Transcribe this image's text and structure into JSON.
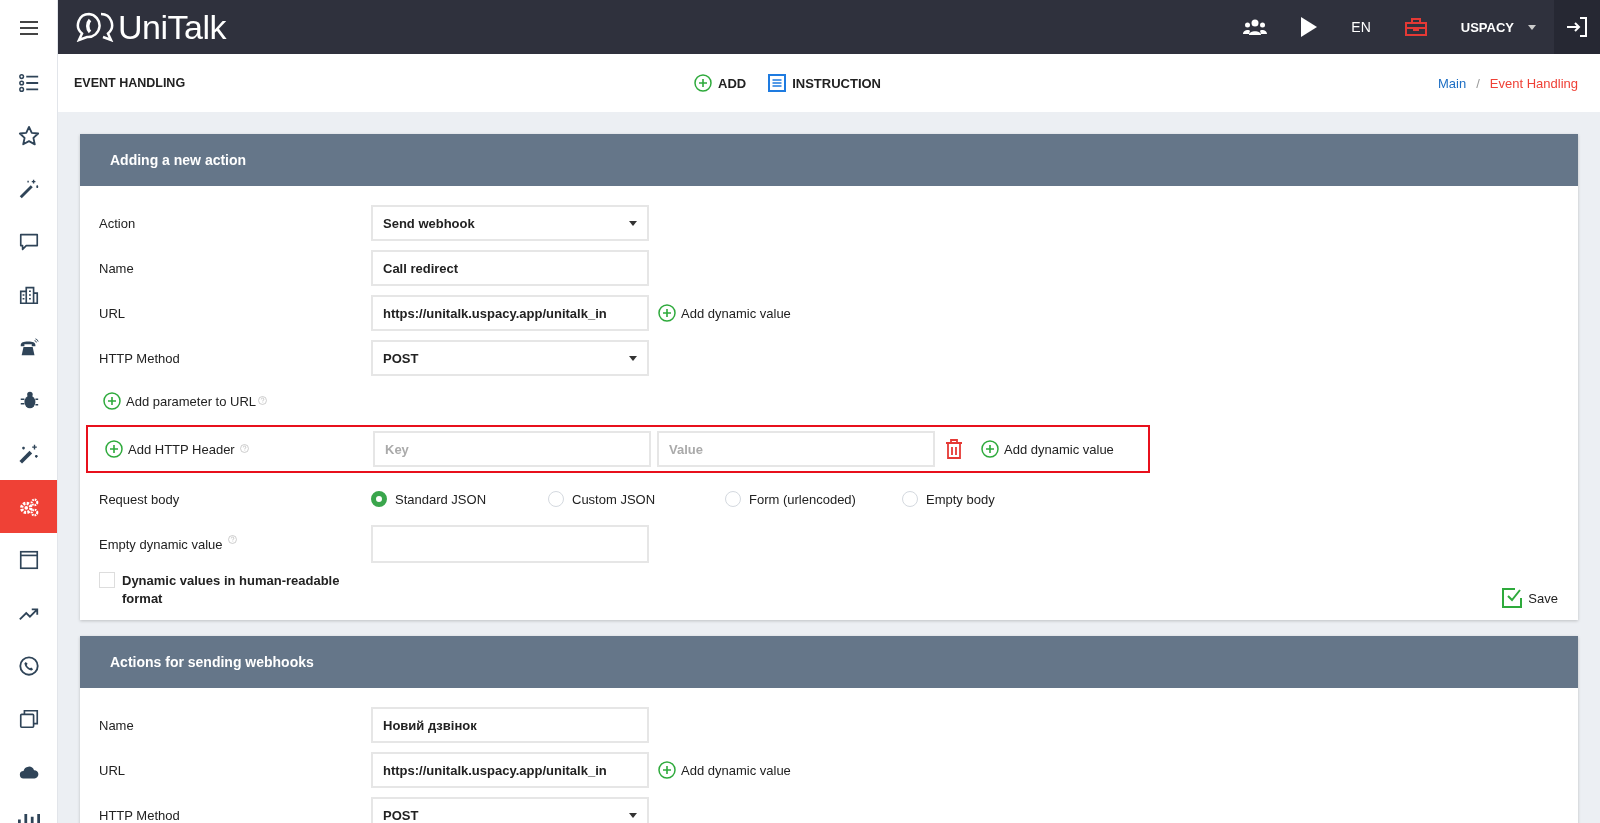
{
  "topbar": {
    "logo": "UniTalk",
    "language": "EN",
    "account": "USPACY"
  },
  "sidebar": {
    "items": [
      {
        "selected": false
      },
      {
        "selected": false
      },
      {
        "selected": false
      },
      {
        "selected": false
      },
      {
        "selected": false
      },
      {
        "selected": false
      },
      {
        "selected": false
      },
      {
        "selected": false
      },
      {
        "selected": true
      },
      {
        "selected": false
      },
      {
        "selected": false
      },
      {
        "selected": false
      },
      {
        "selected": false
      },
      {
        "selected": false
      },
      {
        "selected": false
      }
    ]
  },
  "page_header": {
    "title": "EVENT HANDLING",
    "actions": [
      {
        "kind": "add",
        "label": "ADD"
      },
      {
        "kind": "doc",
        "label": "INSTRUCTION"
      }
    ],
    "breadcrumb_separator": "/",
    "breadcrumbs": [
      {
        "label": "Main",
        "current": false
      },
      {
        "label": "Event Handling",
        "current": true
      }
    ]
  },
  "new_action": {
    "title": "Adding a new action",
    "rows": [
      {
        "kind": "select",
        "label": "Action",
        "value": "Send webhook"
      },
      {
        "kind": "text",
        "label": "Name",
        "value": "Call redirect"
      },
      {
        "kind": "text",
        "label": "URL",
        "value": "https://unitalk.uspacy.app/unitalk_in",
        "link": "Add dynamic value"
      },
      {
        "kind": "select",
        "label": "HTTP Method",
        "value": "POST"
      }
    ],
    "add_parameter": "Add parameter to URL",
    "header_row": {
      "label": "Add HTTP Header",
      "key_placeholder": "Key",
      "value_placeholder": "Value",
      "link": "Add dynamic value",
      "highlighted": true
    },
    "request_body": {
      "label": "Request body",
      "options": [
        {
          "label": "Standard JSON",
          "selected": true
        },
        {
          "label": "Custom JSON",
          "selected": false
        },
        {
          "label": "Form (urlencoded)",
          "selected": false
        },
        {
          "label": "Empty body",
          "selected": false
        }
      ]
    },
    "empty_value_label": "Empty dynamic value",
    "human_readable": {
      "label": "Dynamic values in human-readable format",
      "checked": false
    },
    "save": "Save"
  },
  "webhooks": {
    "title": "Actions for sending webhooks",
    "rows": [
      {
        "kind": "text",
        "label": "Name",
        "value": "Новий дзвінок"
      },
      {
        "kind": "text",
        "label": "URL",
        "value": "https://unitalk.uspacy.app/unitalk_in",
        "link": "Add dynamic value"
      },
      {
        "kind": "select",
        "label": "HTTP Method",
        "value": "POST"
      }
    ]
  }
}
